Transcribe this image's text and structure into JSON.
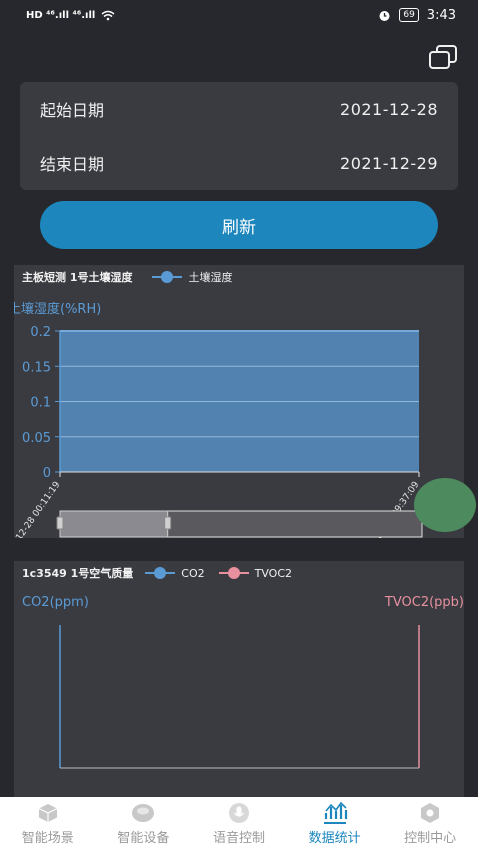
{
  "status_bar": {
    "left_icons": "HD ⁴⁶.ıll ⁴⁶.ıll",
    "battery": "69",
    "time": "3:43"
  },
  "dates": {
    "start_label": "起始日期",
    "start_value": "2021-12-28",
    "end_label": "结束日期",
    "end_value": "2021-12-29"
  },
  "refresh_label": "刷新",
  "chart1": {
    "title": "主板短测 1号土壤湿度",
    "legend": "土壤湿度",
    "color": "#5b9bd5"
  },
  "chart2": {
    "title": "1c3549 1号空气质量",
    "legend_co2": "CO2",
    "legend_tvoc": "TVOC2",
    "ylabel_left": "CO2(ppm)",
    "ylabel_right": "TVOC2(ppb)",
    "co2_color": "#5b9bd5",
    "tvoc_color": "#e8909e"
  },
  "chart_data": [
    {
      "type": "area",
      "title": "主板短测 1号土壤湿度",
      "ylabel": "土壤湿度(%RH)",
      "ylim": [
        0,
        0.2
      ],
      "yticks": [
        "0",
        "0.05",
        "0.1",
        "0.15",
        "0.2"
      ],
      "x_start": "12-28 00:11:19",
      "x_end": "12-28 09:37:09",
      "x_start_label": "12-28 00:11:19",
      "x_end_label": "12-28 09:37:09",
      "series": [
        {
          "name": "土壤湿度",
          "x": [
            "12-28 00:11:19",
            "12-28 09:37:09"
          ],
          "values": [
            0.2,
            0.2
          ]
        }
      ],
      "grid": true,
      "legend": "top"
    },
    {
      "type": "line",
      "title": "1c3549 1号空气质量",
      "ylabel_left": "CO2(ppm)",
      "ylabel_right": "TVOC2(ppb)",
      "series": [
        {
          "name": "CO2",
          "values": []
        },
        {
          "name": "TVOC2",
          "values": []
        }
      ],
      "legend": "top"
    }
  ],
  "slider": {
    "selected_from": 0,
    "selected_to": 0.3
  },
  "nav": [
    {
      "label": "智能场景",
      "icon": "cube-icon"
    },
    {
      "label": "智能设备",
      "icon": "device-icon"
    },
    {
      "label": "语音控制",
      "icon": "microphone-icon"
    },
    {
      "label": "数据统计",
      "icon": "chart-icon"
    },
    {
      "label": "控制中心",
      "icon": "hexagon-icon"
    }
  ],
  "active_nav": 3
}
